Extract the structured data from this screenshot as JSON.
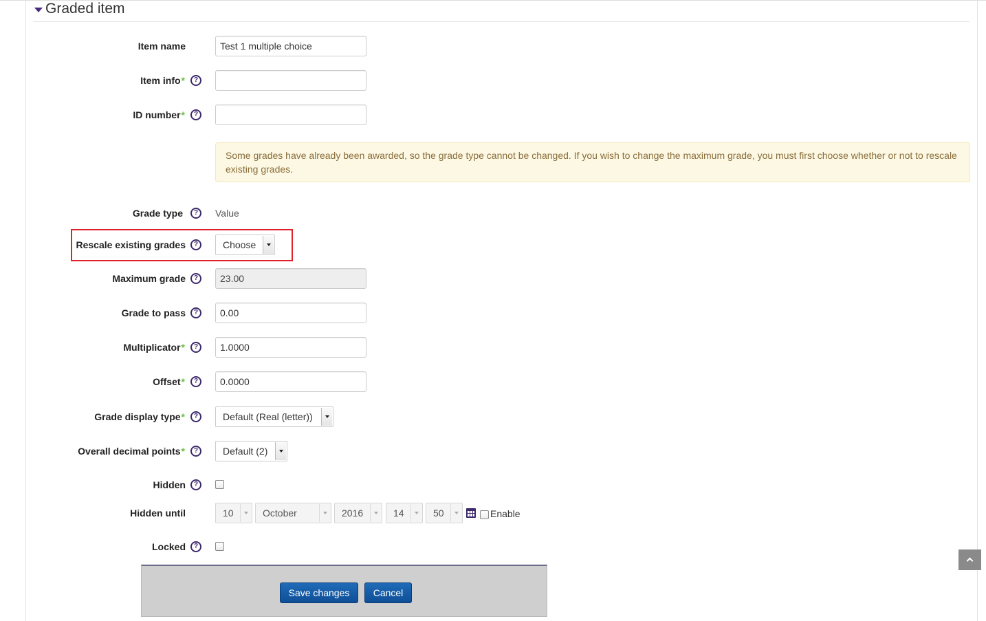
{
  "section": {
    "title": "Graded item"
  },
  "fields": {
    "item_name": {
      "label": "Item name",
      "value": "Test 1 multiple choice"
    },
    "item_info": {
      "label": "Item info",
      "required": "*",
      "value": ""
    },
    "id_number": {
      "label": "ID number",
      "required": "*",
      "value": ""
    },
    "notice": "Some grades have already been awarded, so the grade type cannot be changed. If you wish to change the maximum grade, you must first choose whether or not to rescale existing grades.",
    "grade_type": {
      "label": "Grade type",
      "value": "Value"
    },
    "rescale": {
      "label": "Rescale existing grades",
      "value": "Choose"
    },
    "maximum_grade": {
      "label": "Maximum grade",
      "value": "23.00"
    },
    "grade_to_pass": {
      "label": "Grade to pass",
      "value": "0.00"
    },
    "multiplicator": {
      "label": "Multiplicator",
      "required": "*",
      "value": "1.0000"
    },
    "offset": {
      "label": "Offset",
      "required": "*",
      "value": "0.0000"
    },
    "grade_display_type": {
      "label": "Grade display type",
      "required": "*",
      "value": "Default (Real (letter))"
    },
    "decimal_points": {
      "label": "Overall decimal points",
      "required": "*",
      "value": "Default (2)"
    },
    "hidden": {
      "label": "Hidden"
    },
    "hidden_until": {
      "label": "Hidden until",
      "day": "10",
      "month": "October",
      "year": "2016",
      "hour": "14",
      "minute": "50",
      "enable_label": "Enable"
    },
    "locked": {
      "label": "Locked"
    }
  },
  "help_icon": "?",
  "actions": {
    "save": "Save changes",
    "cancel": "Cancel"
  },
  "colors": {
    "accent": "#3d2a6b",
    "button": "#0f4f97",
    "highlight": "#e0202a",
    "notice_bg": "#fcf8e3"
  }
}
